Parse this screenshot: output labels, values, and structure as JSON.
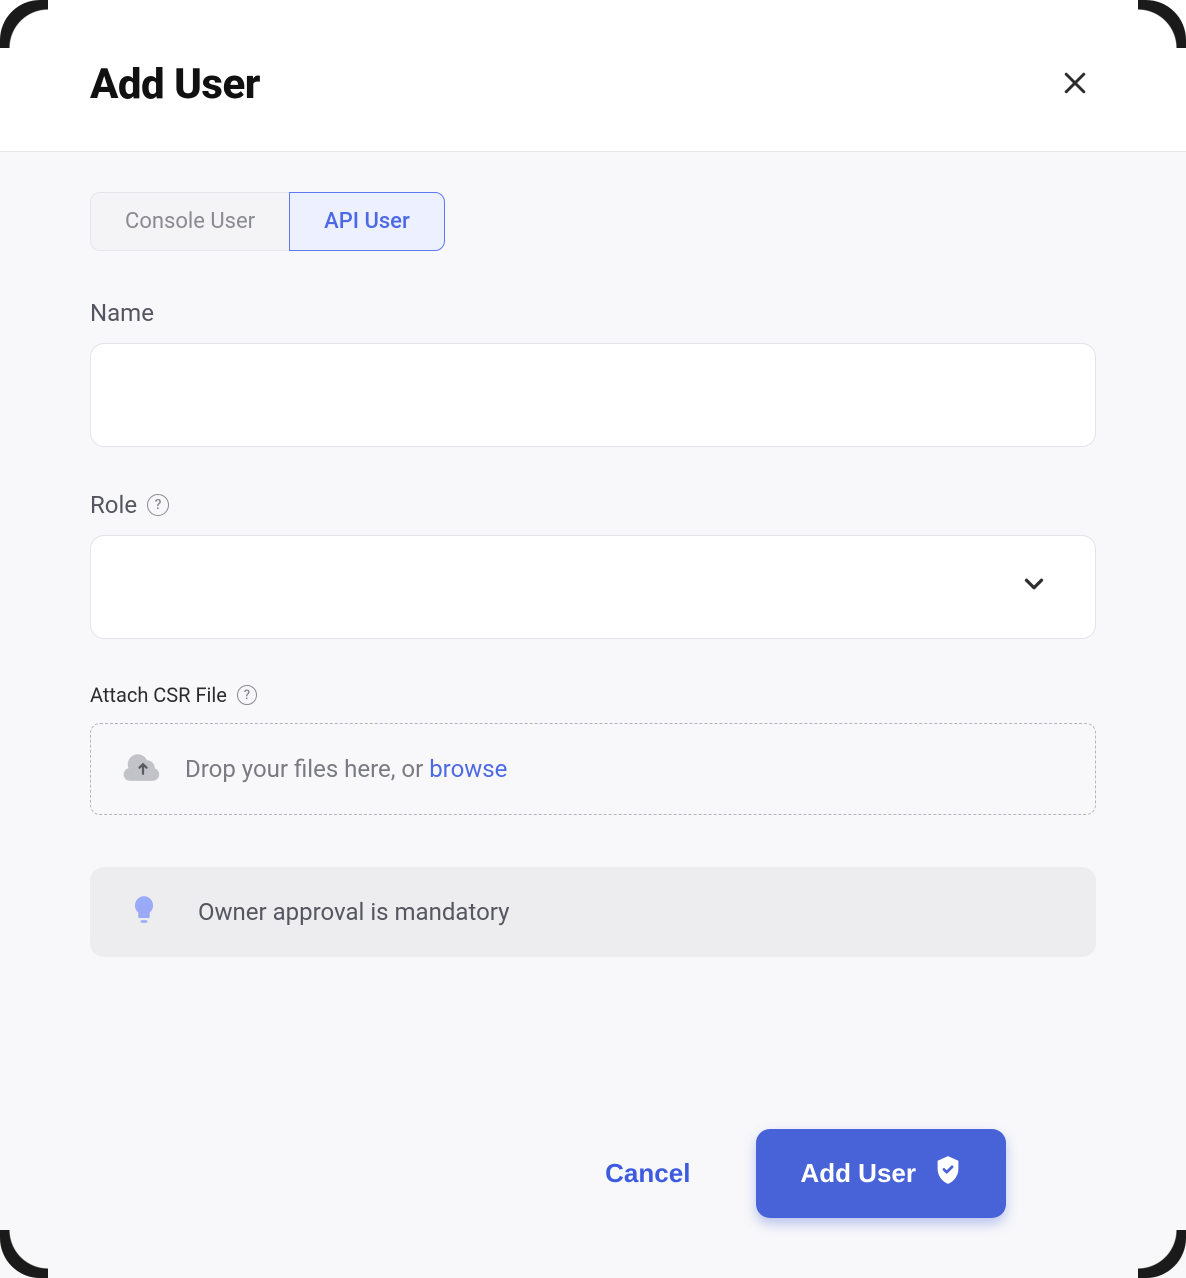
{
  "dialog": {
    "title": "Add User"
  },
  "tabs": {
    "console": "Console User",
    "api": "API User",
    "active": "api"
  },
  "fields": {
    "name": {
      "label": "Name",
      "value": ""
    },
    "role": {
      "label": "Role",
      "value": ""
    },
    "csr": {
      "label": "Attach CSR File",
      "dropText": "Drop your files here, or ",
      "browse": "browse"
    }
  },
  "info": {
    "text": "Owner approval is mandatory"
  },
  "footer": {
    "cancel": "Cancel",
    "submit": "Add User"
  }
}
